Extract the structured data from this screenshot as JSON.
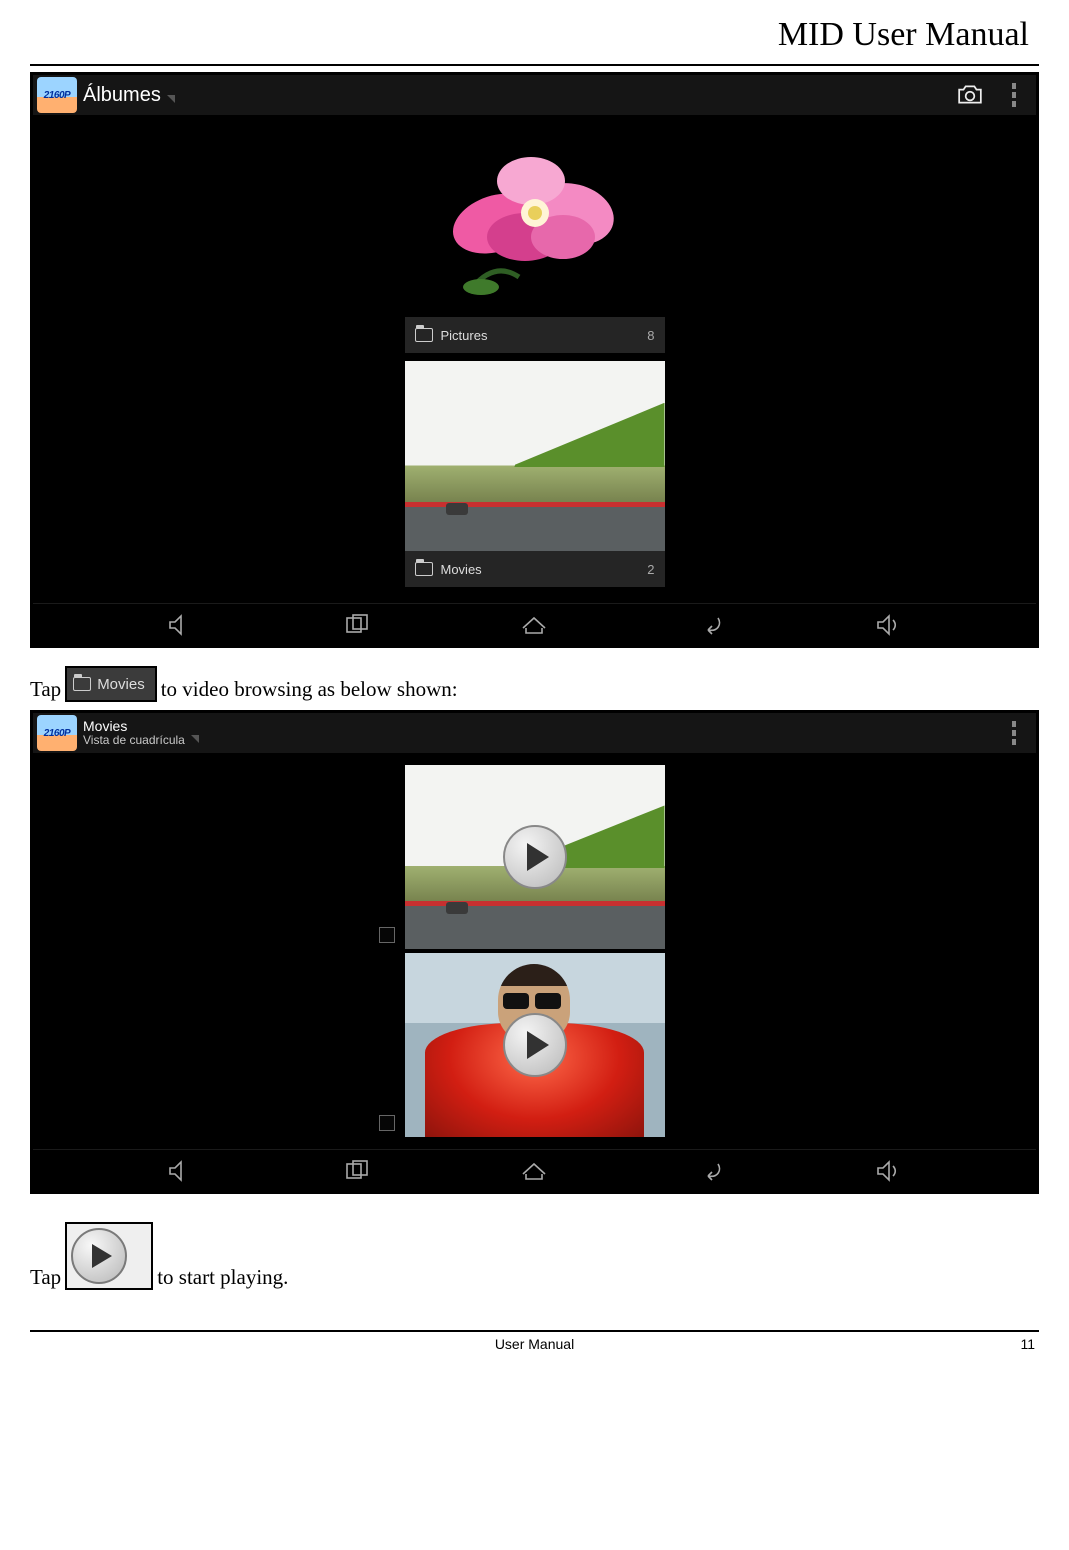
{
  "doc": {
    "header_title": "MID User Manual",
    "footer_center": "User Manual",
    "page_number": "11"
  },
  "text": {
    "tap1_a": "Tap  ",
    "tap1_b": "to video browsing as below shown:",
    "tap2_a": "Tap ",
    "tap2_b": "to start playing."
  },
  "inline_icons": {
    "movies_chip_label": "Movies"
  },
  "screenshot1": {
    "appbar_logo_text": "2160P",
    "appbar_title": "Álbumes",
    "albums": [
      {
        "name": "Pictures",
        "count": "8"
      },
      {
        "name": "Movies",
        "count": "2"
      }
    ]
  },
  "screenshot2": {
    "appbar_logo_text": "2160P",
    "appbar_title_line1": "Movies",
    "appbar_title_line2": "Vista de cuadrícula"
  }
}
